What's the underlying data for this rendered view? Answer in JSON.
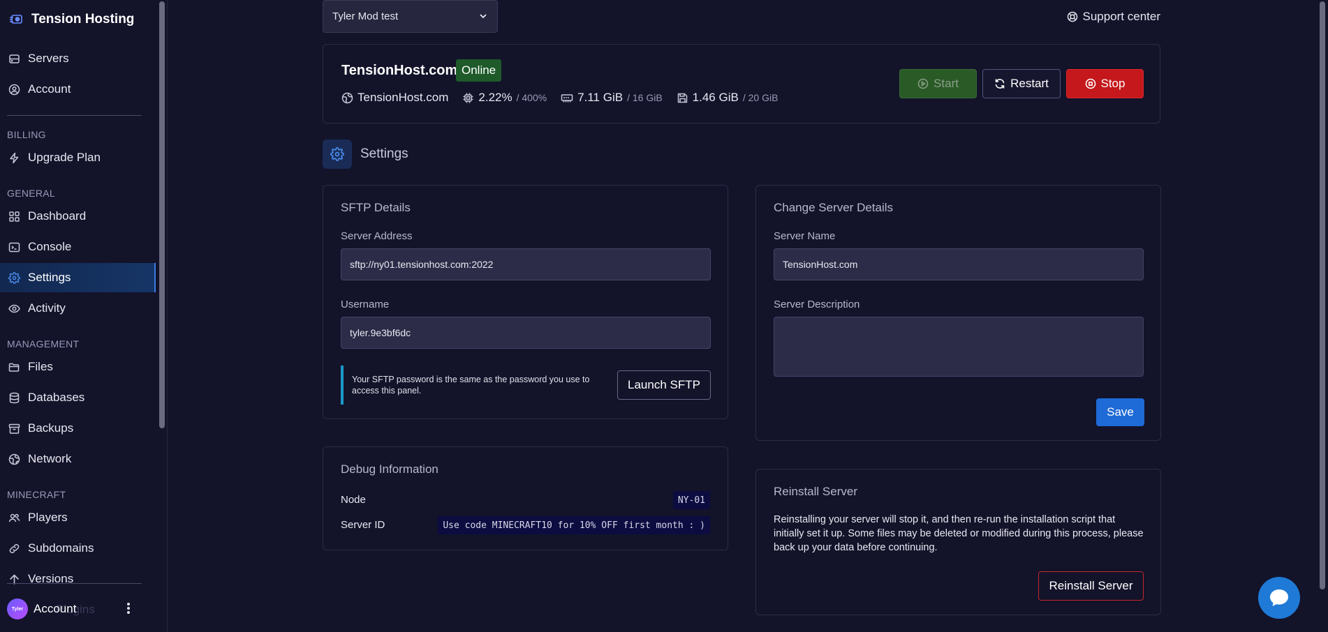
{
  "brand": {
    "title": "Tension Hosting",
    "logo_icon": "rocket-logo-icon"
  },
  "sidebar": {
    "top_items": [
      {
        "label": "Servers",
        "icon": "server-icon"
      },
      {
        "label": "Account",
        "icon": "user-circle-icon"
      }
    ],
    "sections": {
      "billing": "BILLING",
      "general": "GENERAL",
      "management": "MANAGEMENT",
      "minecraft": "MINECRAFT"
    },
    "billing_items": [
      {
        "label": "Upgrade Plan",
        "icon": "lightning-icon"
      }
    ],
    "general_items": [
      {
        "label": "Dashboard",
        "icon": "grid-icon"
      },
      {
        "label": "Console",
        "icon": "terminal-icon"
      },
      {
        "label": "Settings",
        "icon": "gear-icon",
        "active": true
      },
      {
        "label": "Activity",
        "icon": "eye-icon"
      }
    ],
    "management_items": [
      {
        "label": "Files",
        "icon": "folder-icon"
      },
      {
        "label": "Databases",
        "icon": "database-icon"
      },
      {
        "label": "Backups",
        "icon": "archive-icon"
      },
      {
        "label": "Network",
        "icon": "globe-icon"
      }
    ],
    "minecraft_items": [
      {
        "label": "Players",
        "icon": "users-icon"
      },
      {
        "label": "Subdomains",
        "icon": "link-icon"
      },
      {
        "label": "Versions",
        "icon": "arrow-up-icon"
      }
    ],
    "partial_item": "Plugins",
    "account": {
      "avatar_text": "Tyler",
      "label": "Account"
    }
  },
  "topbar": {
    "server_select_value": "Tyler Mod test",
    "support_label": "Support center"
  },
  "server": {
    "name": "TensionHost.com",
    "status": "Online",
    "address": "TensionHost.com",
    "cpu": "2.22%",
    "cpu_limit": "/ 400%",
    "memory": "7.11 GiB",
    "memory_limit": "/ 16 GiB",
    "disk": "1.46 GiB",
    "disk_limit": "/ 20 GiB",
    "start_label": "Start",
    "restart_label": "Restart",
    "stop_label": "Stop",
    "colors": {
      "online": "#1e5a2a",
      "start": "#2a5a26",
      "stop": "#c4181c"
    }
  },
  "settings_title": "Settings",
  "sftp": {
    "title": "SFTP Details",
    "address_label": "Server Address",
    "address_value": "sftp://ny01.tensionhost.com:2022",
    "username_label": "Username",
    "username_value": "tyler.9e3bf6dc",
    "notice": "Your SFTP password is the same as the password you use to access this panel.",
    "launch_label": "Launch SFTP"
  },
  "change_details": {
    "title": "Change Server Details",
    "name_label": "Server Name",
    "name_value": "TensionHost.com",
    "description_label": "Server Description",
    "description_value": "",
    "save_label": "Save"
  },
  "debug": {
    "title": "Debug Information",
    "node_label": "Node",
    "node_value": "NY-01",
    "id_label": "Server ID",
    "id_value": "Use code MINECRAFT10 for 10% OFF first month : )"
  },
  "reinstall": {
    "title": "Reinstall Server",
    "text": "Reinstalling your server will stop it, and then re-run the installation script that initially set it up. Some files may be deleted or modified during this process, please back up your data before continuing.",
    "button_label": "Reinstall Server"
  },
  "accent_color": "#1e6ad6"
}
